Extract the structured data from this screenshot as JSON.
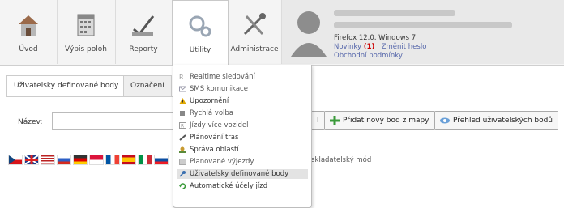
{
  "nav": {
    "items": [
      {
        "label": "Úvod",
        "icon": "house-icon"
      },
      {
        "label": "Výpis poloh",
        "icon": "calendar-icon"
      },
      {
        "label": "Reporty",
        "icon": "pen-check-icon"
      },
      {
        "label": "Utility",
        "icon": "gears-icon"
      },
      {
        "label": "Administrace",
        "icon": "tools-icon"
      }
    ]
  },
  "user": {
    "browser": "Firefox 12.0, Windows 7",
    "news_label": "Novinky",
    "news_count": "(1)",
    "separator": "|",
    "change_password": "Změnit heslo",
    "terms": "Obchodní podmínky"
  },
  "tabs": [
    {
      "label": "Uživatelsky definované body"
    },
    {
      "label": "Označení"
    }
  ],
  "form": {
    "name_label": "Název:",
    "name_value": "",
    "partial_btn_label": "l",
    "add_point_label": "Přidat nový bod z mapy",
    "overview_label": "Přehled uživatelských bodů"
  },
  "translator_mode": "řekladatelský mód",
  "menu": {
    "items": [
      {
        "label": "Realtime sledování",
        "icon": "realtime-icon"
      },
      {
        "label": "SMS komunikace",
        "icon": "sms-icon"
      },
      {
        "label": "Upozornění",
        "icon": "warning-icon"
      },
      {
        "label": "Rychlá volba",
        "icon": "quick-select-icon"
      },
      {
        "label": "Jízdy více vozidel",
        "icon": "multi-vehicle-icon"
      },
      {
        "label": "Plánování tras",
        "icon": "route-planning-icon"
      },
      {
        "label": "Správa oblastí",
        "icon": "area-management-icon"
      },
      {
        "label": "Planované výjezdy",
        "icon": "planned-trips-icon"
      },
      {
        "label": "Uživatelsky definované body",
        "icon": "pin-icon"
      },
      {
        "label": "Automatické účely jízd",
        "icon": "refresh-icon"
      }
    ]
  }
}
